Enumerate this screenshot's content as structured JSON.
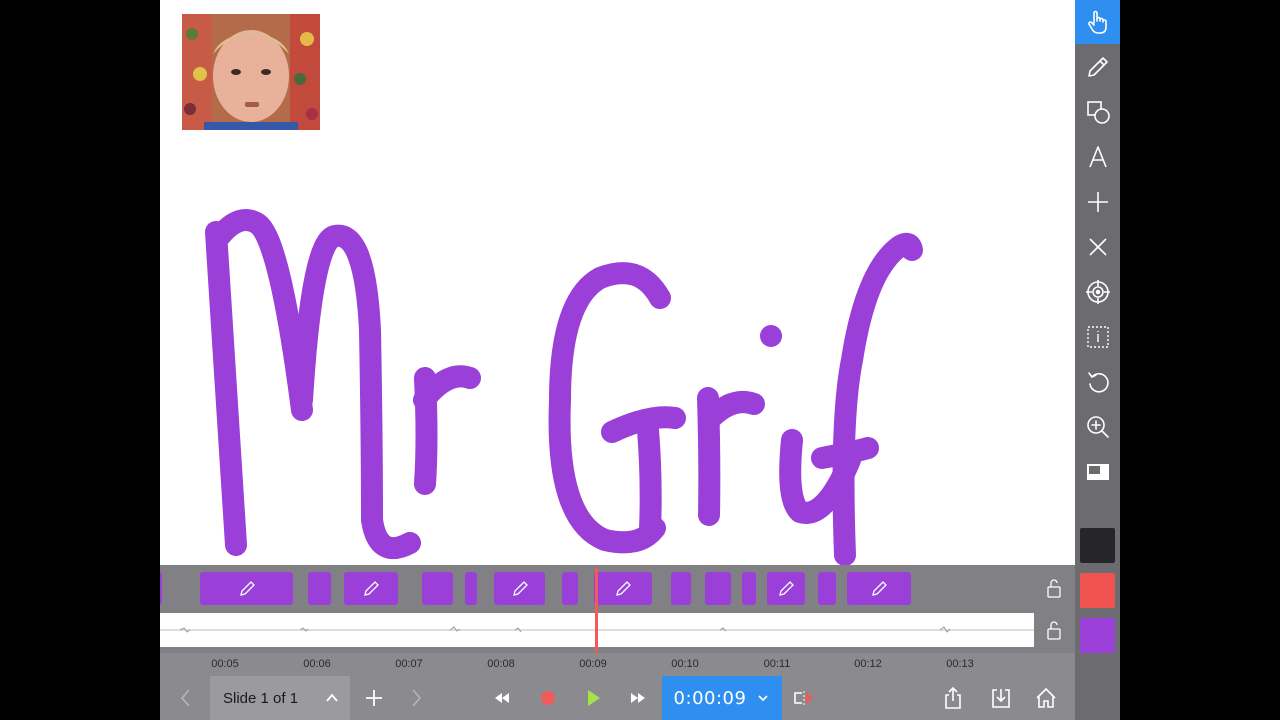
{
  "timeline": {
    "ticks": [
      "00:05",
      "00:06",
      "00:07",
      "00:08",
      "00:09",
      "00:10",
      "00:11",
      "00:12",
      "00:13"
    ]
  },
  "bottom_bar": {
    "slide_label": "Slide 1 of 1",
    "time": "0:00:09"
  },
  "colors": {
    "accent_blue": "#2f8ff0",
    "ink_purple": "#9a3fd8",
    "record_red": "#f05a5a",
    "play_green": "#a6e34a",
    "swatch_black": "#262628",
    "swatch_red": "#f05252",
    "swatch_purple": "#9a3fd8"
  },
  "toolbar": {
    "tools": [
      "hand-pointer-icon",
      "pencil-icon",
      "shapes-icon",
      "text-icon",
      "plus-icon",
      "close-icon",
      "crosshair-icon",
      "text-box-icon",
      "undo-icon",
      "zoom-in-icon",
      "picture-in-picture-icon"
    ]
  }
}
